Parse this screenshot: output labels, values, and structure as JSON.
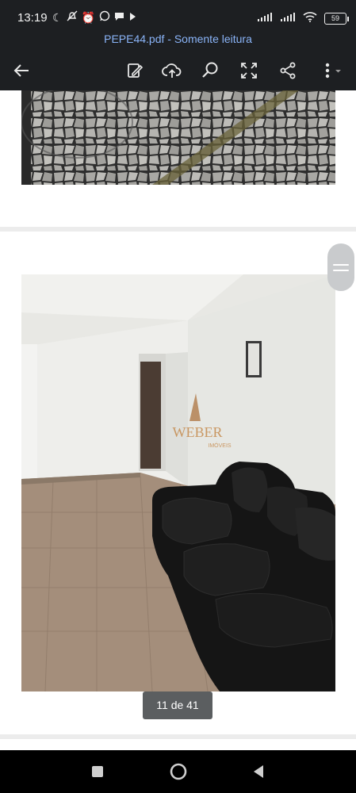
{
  "status_bar": {
    "time": "13:19",
    "battery": "59",
    "icons": [
      "moon-icon",
      "bell-off-icon",
      "alarm-icon",
      "whatsapp-icon",
      "chat-bubble-icon",
      "play-icon",
      "signal-icon",
      "signal-icon",
      "wifi-icon",
      "battery-icon"
    ]
  },
  "document": {
    "title": "PEPE44.pdf - Somente leitura"
  },
  "toolbar": {
    "buttons": [
      "back-arrow-icon",
      "edit-icon",
      "cloud-upload-icon",
      "search-icon",
      "fit-screen-icon",
      "share-icon",
      "more-menu-icon"
    ]
  },
  "viewer": {
    "page_indicator": "11 de 41",
    "watermark": {
      "brand": "WEBER",
      "sub": "IMÓVEIS"
    }
  },
  "nav_bar": {
    "buttons": [
      "recents-square-icon",
      "home-circle-icon",
      "back-triangle-icon"
    ]
  },
  "colors": {
    "bar_bg": "#1d1f22",
    "title_link": "#8ab4f8",
    "indicator_bg": "#5b5e60",
    "page_separator": "#ececec"
  }
}
